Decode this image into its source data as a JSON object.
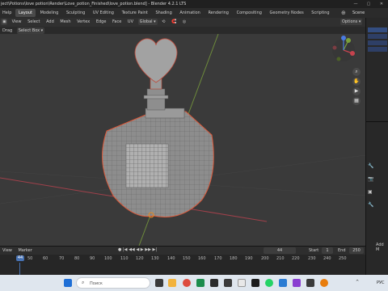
{
  "titlebar": {
    "path": "ject\\Potions\\love potion\\Render\\Love_potion_Finished\\love_potion.blend] - Blender 4.2.1 LTS",
    "minimize": "—",
    "maximize": "▢",
    "close": "✕"
  },
  "menubar": {
    "help": "Help",
    "tabs": [
      "Layout",
      "Modeling",
      "Sculpting",
      "UV Editing",
      "Texture Paint",
      "Shading",
      "Animation",
      "Rendering",
      "Compositing",
      "Geometry Nodes",
      "Scripting"
    ],
    "scene_label": "Scene"
  },
  "header1": {
    "view": "View",
    "select": "Select",
    "add": "Add",
    "mesh": "Mesh",
    "vertex": "Vertex",
    "edge": "Edge",
    "face": "Face",
    "uv": "UV",
    "global": "Global",
    "options": "Options"
  },
  "header2": {
    "drag": "Drag",
    "select_box": "Select Box"
  },
  "timeline": {
    "view": "View",
    "marker": "Marker",
    "current_frame": "44",
    "start_label": "Start",
    "start_value": "1",
    "end_label": "End",
    "end_value": "250",
    "ruler": [
      "44",
      "50",
      "60",
      "70",
      "80",
      "90",
      "100",
      "110",
      "120",
      "130",
      "140",
      "150",
      "160",
      "170",
      "180",
      "190",
      "200",
      "210",
      "220",
      "230",
      "240",
      "250"
    ]
  },
  "rightpanel": {
    "add_mod": "Add M"
  },
  "taskbar": {
    "search_placeholder": "Поиск",
    "lang": "РУС"
  },
  "colors": {
    "viewport_bg": "#3a3a3a",
    "accent_blue": "#4772b3",
    "selection_orange": "#e88a20",
    "taskbar": "#dfe6ee"
  }
}
